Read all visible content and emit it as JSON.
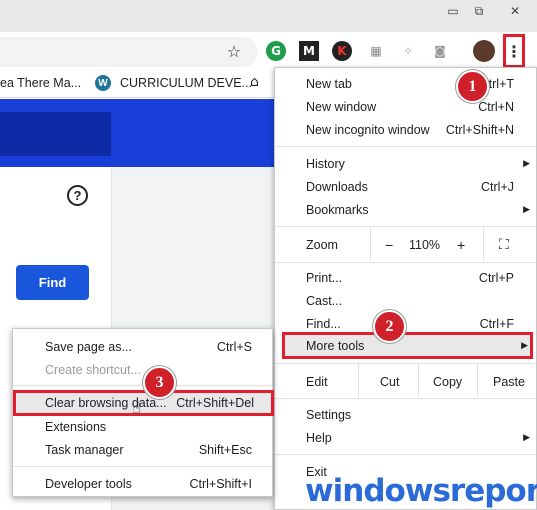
{
  "bookmarks": [
    "ea There Ma...",
    "CURRICULUM DEVE..."
  ],
  "page": {
    "find_label": "Find",
    "help_icon": "?"
  },
  "main_menu": {
    "new_tab": "New tab",
    "new_tab_sc": "Ctrl+T",
    "new_window": "New window",
    "new_window_sc": "Ctrl+N",
    "incognito": "New incognito window",
    "incognito_sc": "Ctrl+Shift+N",
    "history": "History",
    "downloads": "Downloads",
    "downloads_sc": "Ctrl+J",
    "bookmarks": "Bookmarks",
    "zoom": "Zoom",
    "zoom_minus": "−",
    "zoom_value": "110%",
    "zoom_plus": "+",
    "print": "Print...",
    "print_sc": "Ctrl+P",
    "cast": "Cast...",
    "find": "Find...",
    "find_sc": "Ctrl+F",
    "more_tools": "More tools",
    "edit": "Edit",
    "cut": "Cut",
    "copy": "Copy",
    "paste": "Paste",
    "settings": "Settings",
    "help": "Help",
    "exit": "Exit"
  },
  "submenu": {
    "save_page": "Save page as...",
    "save_page_sc": "Ctrl+S",
    "create_shortcut": "Create shortcut...",
    "clear_browsing": "Clear browsing data...",
    "clear_browsing_sc": "Ctrl+Shift+Del",
    "extensions": "Extensions",
    "task_manager": "Task manager",
    "task_manager_sc": "Shift+Esc",
    "developer_tools": "Developer tools",
    "developer_tools_sc": "Ctrl+Shift+I"
  },
  "badges": [
    "1",
    "2",
    "3"
  ],
  "watermark": "windowsreport",
  "colors": {
    "accent_blue": "#1a3fd8",
    "highlight_red": "#e01e2c",
    "badge_red": "#d0202a",
    "find_button": "#1a56db"
  }
}
